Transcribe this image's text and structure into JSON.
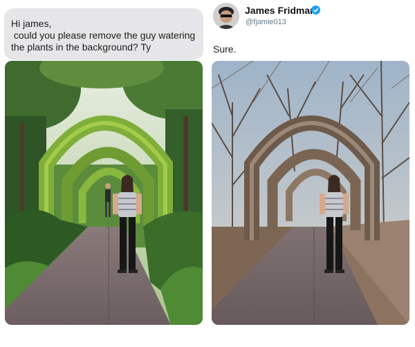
{
  "request": {
    "text": "Hi james,\n could you please remove the guy watering\nthe plants in the background? Ty"
  },
  "response": {
    "name": "James Fridman",
    "handle": "@fjamie013",
    "text": "Sure.",
    "verified_icon": "verified-badge-icon",
    "verified_color": "#1da1f2"
  },
  "photos": {
    "original": "garden path with green vine arches, woman in striped top and man watering plants in background",
    "edited": "same path with bare dried-branch arches and dead trees, man removed"
  }
}
